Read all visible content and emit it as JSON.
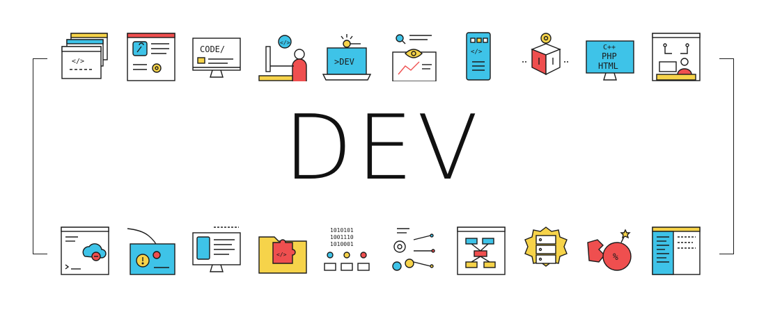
{
  "title": "DEV",
  "icons": {
    "code_window": "</>",
    "monitor_code": "CODE/",
    "dev_laptop": ">DEV",
    "lang_cpp": "C++",
    "lang_php": "PHP",
    "lang_html": "HTML",
    "binary_1": "1010101",
    "binary_2": "1001110",
    "binary_3": "1010001",
    "percent": "%"
  },
  "colors": {
    "outline": "#1b1b1b",
    "yellow": "#f6d34a",
    "red": "#ef4f4f",
    "blue": "#3ec3e8"
  }
}
